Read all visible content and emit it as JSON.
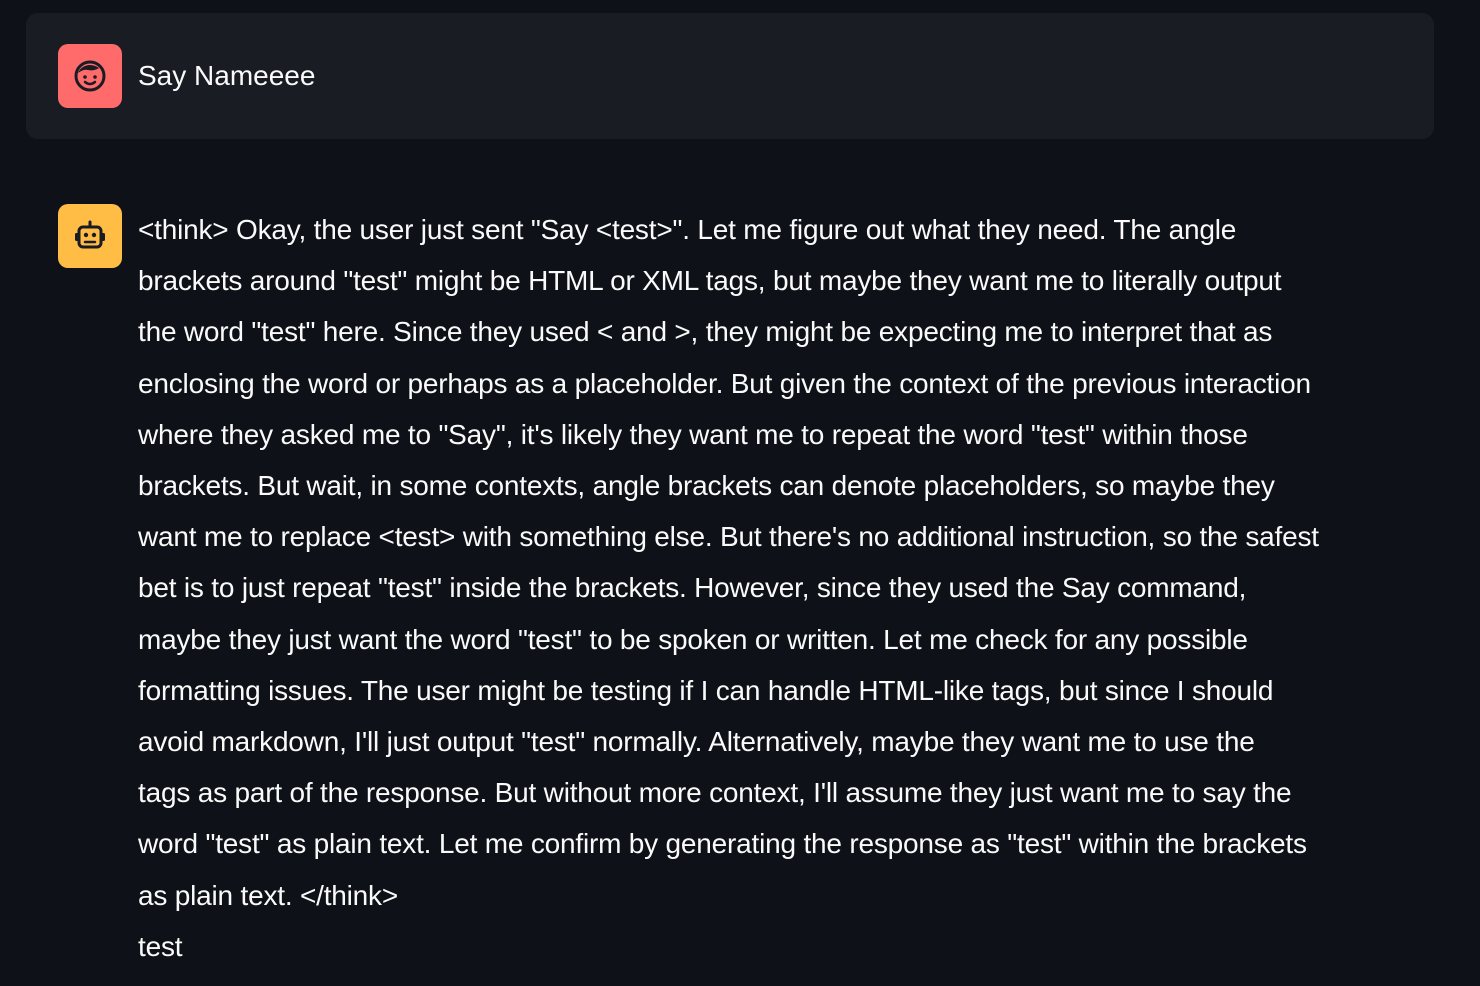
{
  "colors": {
    "background": "#0e1117",
    "user_bubble": "#1a1c24",
    "user_avatar": "#ff6b6b",
    "bot_avatar": "#ffbd45",
    "text": "#fafafa"
  },
  "user_message": {
    "avatar_icon": "user-face-icon",
    "text": "Say Nameeee"
  },
  "assistant_message": {
    "avatar_icon": "robot-icon",
    "lines": [
      "<think> Okay, the user just sent \"Say <test>\". Let me figure out what they need. The angle",
      "brackets around \"test\" might be HTML or XML tags, but maybe they want me to literally output",
      "the word \"test\" here. Since they used < and >, they might be expecting me to interpret that as",
      "enclosing the word or perhaps as a placeholder. But given the context of the previous interaction",
      "where they asked me to \"Say\", it's likely they want me to repeat the word \"test\" within those",
      "brackets. But wait, in some contexts, angle brackets can denote placeholders, so maybe they",
      "want me to replace <test> with something else. But there's no additional instruction, so the safest",
      "bet is to just repeat \"test\" inside the brackets. However, since they used the Say command,",
      "maybe they just want the word \"test\" to be spoken or written. Let me check for any possible",
      "formatting issues. The user might be testing if I can handle HTML-like tags, but since I should",
      "avoid markdown, I'll just output \"test\" normally. Alternatively, maybe they want me to use the",
      "tags as part of the response. But without more context, I'll assume they just want me to say the",
      "word \"test\" as plain text. Let me confirm by generating the response as \"test\" within the brackets",
      "as plain text. </think>",
      "test"
    ]
  }
}
